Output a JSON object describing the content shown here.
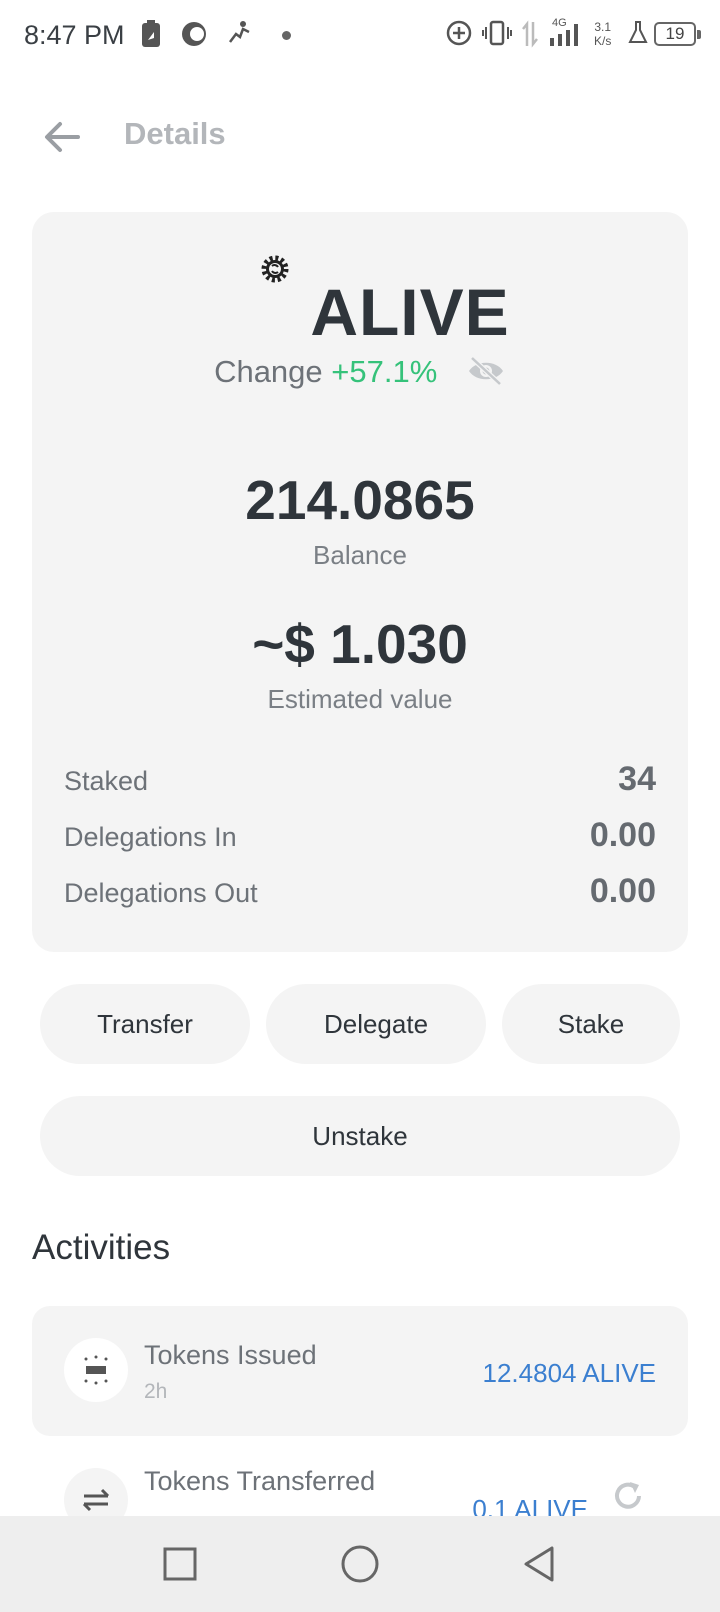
{
  "status_bar": {
    "time": "8:47 PM",
    "network_type": "4G",
    "net_speed_value": "3.1",
    "net_speed_unit": "K/s",
    "battery": "19"
  },
  "header": {
    "title": "Details",
    "back_icon": "arrow-left-icon"
  },
  "token": {
    "icon": "token-gear-icon",
    "name": "ALIVE",
    "change_label": "Change",
    "change_value": "+57.1%",
    "change_color": "#35c27a",
    "visibility_icon": "eye-off-icon",
    "balance": "214.0865",
    "balance_label": "Balance",
    "estimated_value": "~$ 1.030",
    "estimated_label": "Estimated value"
  },
  "stats": [
    {
      "label": "Staked",
      "value": "34"
    },
    {
      "label": "Delegations In",
      "value": "0.00"
    },
    {
      "label": "Delegations Out",
      "value": "0.00"
    }
  ],
  "actions": {
    "transfer": "Transfer",
    "delegate": "Delegate",
    "stake": "Stake",
    "unstake": "Unstake"
  },
  "activities": {
    "title": "Activities",
    "items": [
      {
        "title": "Tokens Issued",
        "time": "2h",
        "amount": "12.4804 ALIVE",
        "icon": "tokens-issued-icon"
      },
      {
        "title": "Tokens Transferred",
        "time": "",
        "amount": "0.1 ALIVE",
        "icon": "transfer-arrows-icon"
      }
    ],
    "amount_color": "#3b7fd0",
    "refresh_icon": "refresh-icon"
  },
  "nav": {
    "recents_icon": "square-icon",
    "home_icon": "circle-icon",
    "back_icon": "triangle-back-icon"
  }
}
